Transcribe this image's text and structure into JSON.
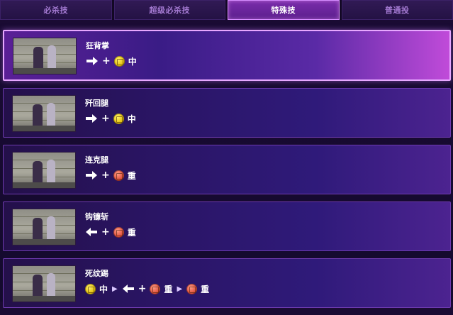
{
  "tabs": [
    {
      "label": "必杀技",
      "active": false
    },
    {
      "label": "超级必杀技",
      "active": false
    },
    {
      "label": "特殊技",
      "active": true
    },
    {
      "label": "普通投",
      "active": false
    }
  ],
  "moves": [
    {
      "name": "狂背掌",
      "active": true,
      "command": [
        {
          "type": "arrow",
          "dir": "right"
        },
        {
          "type": "plus",
          "text": "+"
        },
        {
          "type": "button",
          "kind": "kick",
          "icon": "yellow-kick-button-icon"
        },
        {
          "type": "level",
          "text": "中"
        }
      ]
    },
    {
      "name": "歼回腿",
      "active": false,
      "command": [
        {
          "type": "arrow",
          "dir": "right"
        },
        {
          "type": "plus",
          "text": "+"
        },
        {
          "type": "button",
          "kind": "kick",
          "icon": "yellow-kick-button-icon"
        },
        {
          "type": "level",
          "text": "中"
        }
      ]
    },
    {
      "name": "连克腿",
      "active": false,
      "command": [
        {
          "type": "arrow",
          "dir": "right"
        },
        {
          "type": "plus",
          "text": "+"
        },
        {
          "type": "button",
          "kind": "heavy",
          "icon": "red-punch-button-icon"
        },
        {
          "type": "level",
          "text": "重"
        }
      ]
    },
    {
      "name": "钩镰斩",
      "active": false,
      "command": [
        {
          "type": "arrow",
          "dir": "left"
        },
        {
          "type": "plus",
          "text": "+"
        },
        {
          "type": "button",
          "kind": "heavy",
          "icon": "red-punch-button-icon"
        },
        {
          "type": "level",
          "text": "重"
        }
      ]
    },
    {
      "name": "死纹踢",
      "active": false,
      "command": [
        {
          "type": "button",
          "kind": "kick",
          "icon": "yellow-kick-button-icon"
        },
        {
          "type": "level",
          "text": "中"
        },
        {
          "type": "sep",
          "text": "▶"
        },
        {
          "type": "arrow",
          "dir": "left"
        },
        {
          "type": "plus",
          "text": "+"
        },
        {
          "type": "button",
          "kind": "heavy",
          "icon": "red-punch-button-icon"
        },
        {
          "type": "level",
          "text": "重"
        },
        {
          "type": "sep",
          "text": "▶"
        },
        {
          "type": "button",
          "kind": "heavy",
          "icon": "red-punch-button-icon"
        },
        {
          "type": "level",
          "text": "重"
        }
      ]
    }
  ],
  "colors": {
    "accent": "#c04bd9",
    "tab_active": "#7a2cab",
    "kick": "#e3c20f",
    "heavy": "#e0523e"
  }
}
